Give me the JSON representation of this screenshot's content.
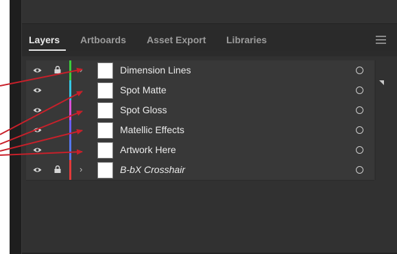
{
  "tabs": [
    {
      "label": "Layers"
    },
    {
      "label": "Artboards"
    },
    {
      "label": "Asset Export"
    },
    {
      "label": "Libraries"
    }
  ],
  "layers": [
    {
      "name": "Dimension Lines",
      "color": "#3ccd3c",
      "visible": true,
      "locked": true,
      "expandable": true,
      "italic": false
    },
    {
      "name": "Spot Matte",
      "color": "#35c8e6",
      "visible": true,
      "locked": false,
      "expandable": false,
      "italic": false
    },
    {
      "name": "Spot Gloss",
      "color": "#d94fd6",
      "visible": true,
      "locked": false,
      "expandable": false,
      "italic": false
    },
    {
      "name": "Matellic Effects",
      "color": "#6a5cf0",
      "visible": true,
      "locked": false,
      "expandable": false,
      "italic": false
    },
    {
      "name": "Artwork Here",
      "color": "#5577ee",
      "visible": true,
      "locked": false,
      "expandable": false,
      "italic": false
    },
    {
      "name": "B-bX Crosshair",
      "color": "#e23a3a",
      "visible": true,
      "locked": true,
      "expandable": true,
      "italic": true
    }
  ],
  "icons": {
    "eye": "eye-icon",
    "lock": "lock-icon",
    "chevron": "chevron-right-icon",
    "target": "target-circle-icon",
    "menu": "hamburger-menu-icon"
  },
  "annotation_color": "#c8202a"
}
